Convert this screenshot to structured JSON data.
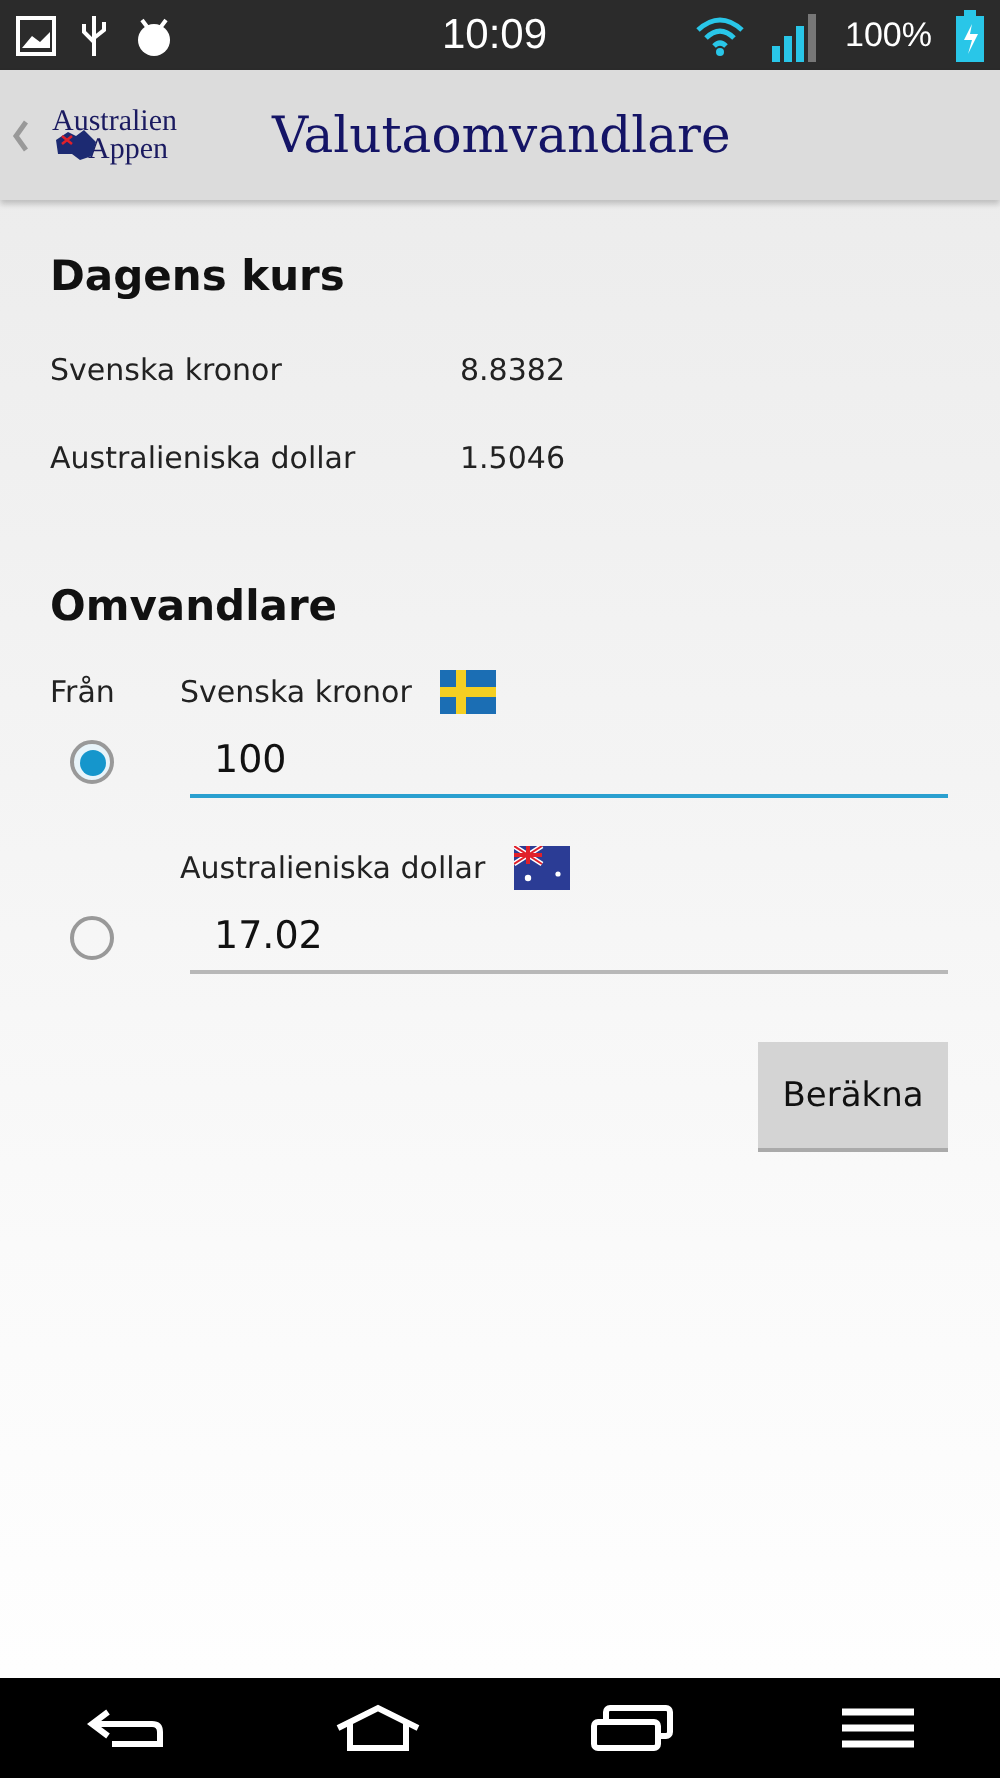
{
  "status_bar": {
    "time": "10:09",
    "battery": "100%"
  },
  "action_bar": {
    "logo_line_1": "Australien",
    "logo_line_2": "Appen",
    "title": "Valutaomvandlare"
  },
  "rates": {
    "heading": "Dagens kurs",
    "rows": [
      {
        "label": "Svenska kronor",
        "value": "8.8382"
      },
      {
        "label": "Australieniska dollar",
        "value": "1.5046"
      }
    ]
  },
  "converter": {
    "heading": "Omvandlare",
    "from_label": "Från",
    "currencies": [
      {
        "name": "Svenska kronor",
        "kind": "sweden",
        "value": "100",
        "selected": true,
        "focused": true
      },
      {
        "name": "Australieniska dollar",
        "kind": "australia",
        "value": "17.02",
        "selected": false,
        "focused": false
      }
    ],
    "button": "Beräkna"
  }
}
